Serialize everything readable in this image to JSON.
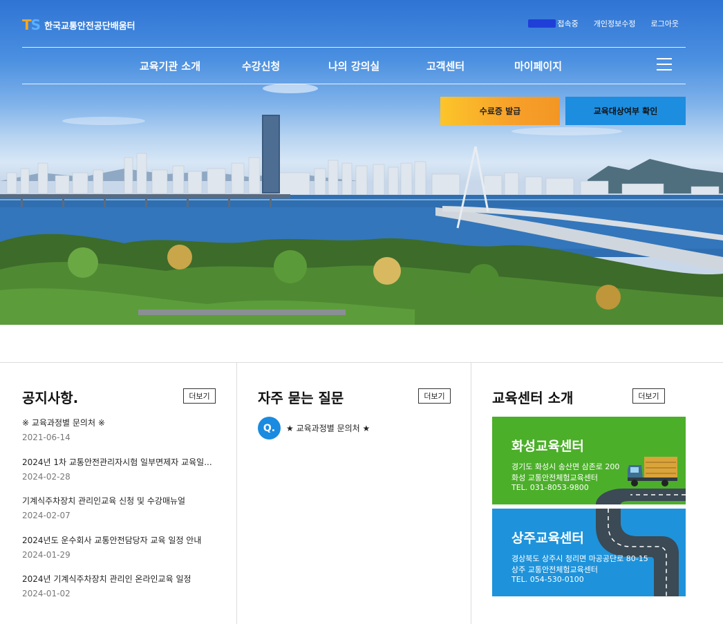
{
  "header": {
    "logo_mark_t": "T",
    "logo_mark_s": "S",
    "logo_text": "한국교통안전공단배움터",
    "util": {
      "status": "접속중",
      "edit_profile": "개인정보수정",
      "logout": "로그아웃"
    },
    "nav": [
      "교육기관 소개",
      "수강신청",
      "나의 강의실",
      "고객센터",
      "마이페이지"
    ],
    "menu_icon": "hamburger-icon"
  },
  "hero": {
    "btn_certificate": "수료증 발급",
    "btn_eligibility": "교육대상여부 확인"
  },
  "notice": {
    "title": "공지사항.",
    "more": "더보기",
    "items": [
      {
        "title": "※ 교육과정별 문의처 ※",
        "date": "2021-06-14"
      },
      {
        "title": "2024년 1차 교통안전관리자시험 일부면제자 교육일...",
        "date": "2024-02-28"
      },
      {
        "title": "기계식주차장치 관리인교육 신청 및 수강매뉴얼",
        "date": "2024-02-07"
      },
      {
        "title": "2024년도 운수회사 교통안전담당자 교육 일정 안내",
        "date": "2024-01-29"
      },
      {
        "title": "2024년 기계식주차장치 관리인 온라인교육 일정",
        "date": "2024-01-02"
      }
    ]
  },
  "faq": {
    "title": "자주 묻는 질문",
    "more": "더보기",
    "badge": "Q.",
    "items": [
      {
        "title": "★ 교육과정별 문의처 ★"
      }
    ]
  },
  "centers": {
    "title": "교육센터 소개",
    "more": "더보기",
    "items": [
      {
        "name": "화성교육센터",
        "address": "경기도 화성시 송산면 삼존로 200",
        "facility": "화성 교통안전체험교육센터",
        "tel": "TEL. 031-8053-9800",
        "color": "#4caf2a"
      },
      {
        "name": "상주교육센터",
        "address": "경상북도 상주시 청리면 마공공단로 80-15",
        "facility": "상주 교통안전체험교육센터",
        "tel": "TEL. 054-530-0100",
        "color": "#1e93db"
      }
    ]
  }
}
